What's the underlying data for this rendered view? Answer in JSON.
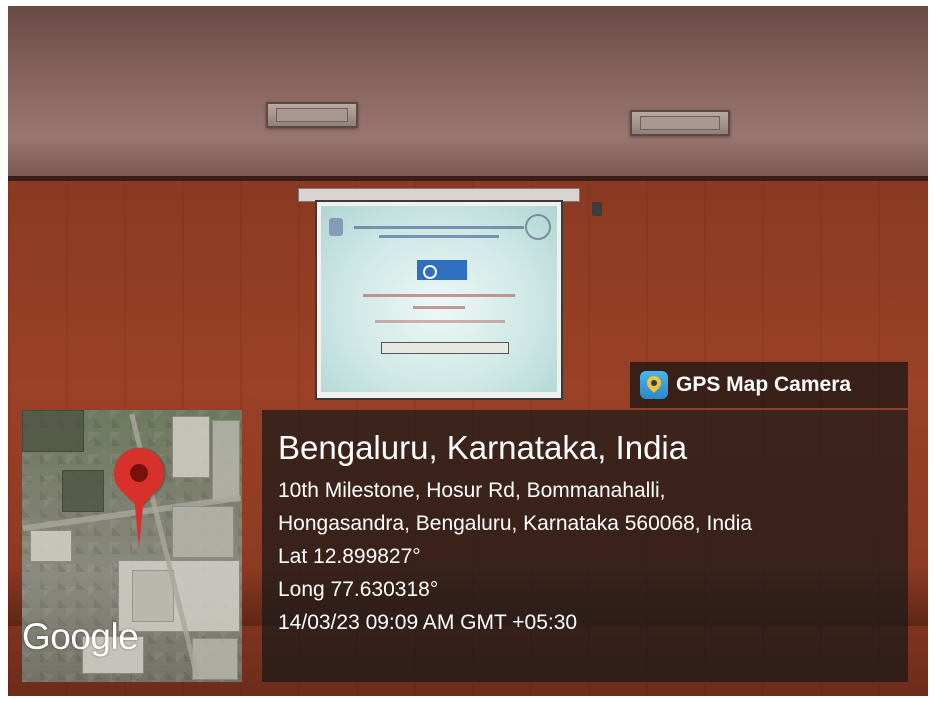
{
  "overlay": {
    "app_name": "GPS Map Camera",
    "app_icon": "gps-map-camera-icon",
    "map_watermark": "Google",
    "location_title": "Bengaluru, Karnataka, India",
    "address_line_1": "10th Milestone, Hosur Rd, Bommanahalli,",
    "address_line_2": "Hongasandra, Bengaluru, Karnataka 560068, India",
    "latitude": "Lat 12.899827°",
    "longitude": "Long 77.630318°",
    "timestamp": "14/03/23 09:09 AM GMT +05:30"
  },
  "colors": {
    "pin": "#d8312c",
    "overlay_bg": "rgba(25,25,25,0.72)",
    "wall": "#9a4126"
  }
}
